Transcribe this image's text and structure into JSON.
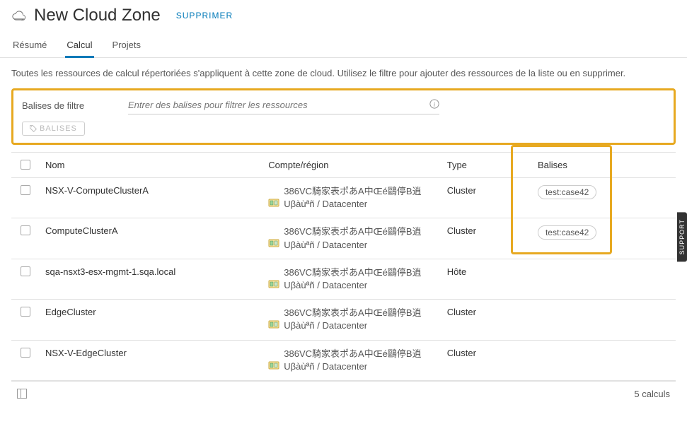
{
  "header": {
    "title": "New Cloud Zone",
    "delete": "Supprimer"
  },
  "tabs": {
    "summary": "Résumé",
    "compute": "Calcul",
    "projects": "Projets"
  },
  "description": "Toutes les ressources de calcul répertoriées s'appliquent à cette zone de cloud. Utilisez le filtre pour ajouter des ressources de la liste ou en supprimer.",
  "filter": {
    "label": "Balises de filtre",
    "placeholder": "Entrer des balises pour filtrer les ressources",
    "tagsButton": "BALISES"
  },
  "table": {
    "headers": {
      "name": "Nom",
      "account": "Compte/région",
      "type": "Type",
      "tags": "Balises"
    },
    "rows": [
      {
        "name": "NSX-V-ComputeClusterA",
        "account": "386VC騎家表ポあA中Œé鷗停B逍Uβàùªñ / Datacenter",
        "type": "Cluster",
        "tag": "test:case42"
      },
      {
        "name": "ComputeClusterA",
        "account": "386VC騎家表ポあA中Œé鷗停B逍Uβàùªñ / Datacenter",
        "type": "Cluster",
        "tag": "test:case42"
      },
      {
        "name": "sqa-nsxt3-esx-mgmt-1.sqa.local",
        "account": "386VC騎家表ポあA中Œé鷗停B逍Uβàùªñ / Datacenter",
        "type": "Hôte",
        "tag": ""
      },
      {
        "name": "EdgeCluster",
        "account": "386VC騎家表ポあA中Œé鷗停B逍Uβàùªñ / Datacenter",
        "type": "Cluster",
        "tag": ""
      },
      {
        "name": "NSX-V-EdgeCluster",
        "account": "386VC騎家表ポあA中Œé鷗停B逍Uβàùªñ / Datacenter",
        "type": "Cluster",
        "tag": ""
      }
    ]
  },
  "footer": {
    "count": "5 calculs"
  },
  "support": "SUPPORT"
}
